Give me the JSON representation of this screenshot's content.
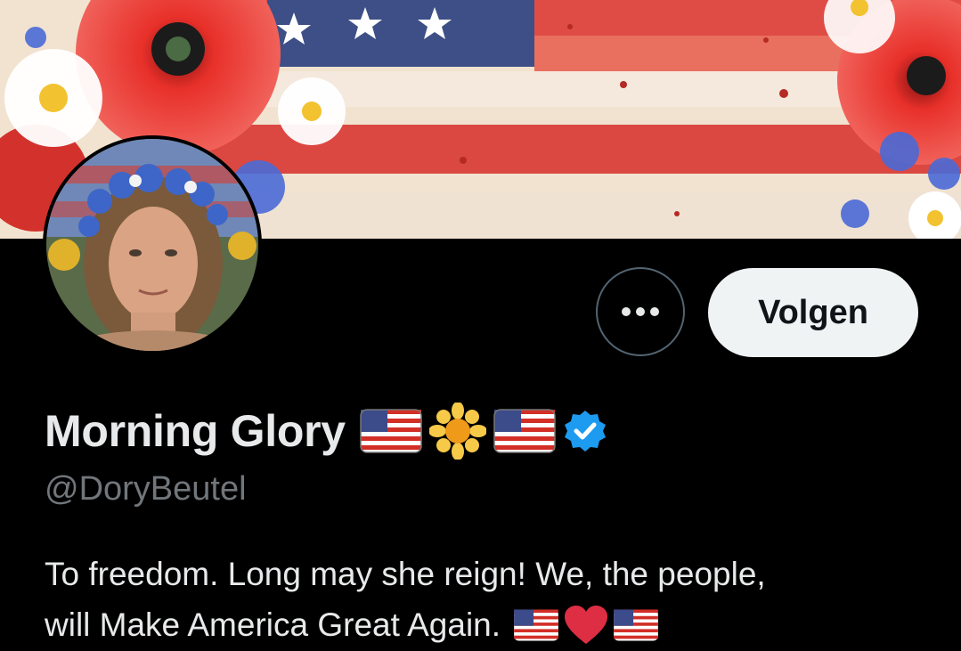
{
  "profile": {
    "display_name": "Morning Glory",
    "name_emojis": [
      "us-flag-icon",
      "blossom-icon",
      "us-flag-icon",
      "verified-badge-icon"
    ],
    "handle": "@DoryBeutel",
    "follow_label": "Volgen",
    "more_icon": "more-dots-icon",
    "bio": {
      "line1": "To freedom. Long may she reign! We, the people,",
      "line2": "will Make America Great Again.",
      "line2_emojis": [
        "us-flag-icon",
        "red-heart-icon",
        "us-flag-icon"
      ]
    }
  },
  "colors": {
    "background": "#000000",
    "follow_button_bg": "#eff3f4",
    "verified_blue": "#1d9bf0",
    "handle_gray": "#71767b"
  }
}
